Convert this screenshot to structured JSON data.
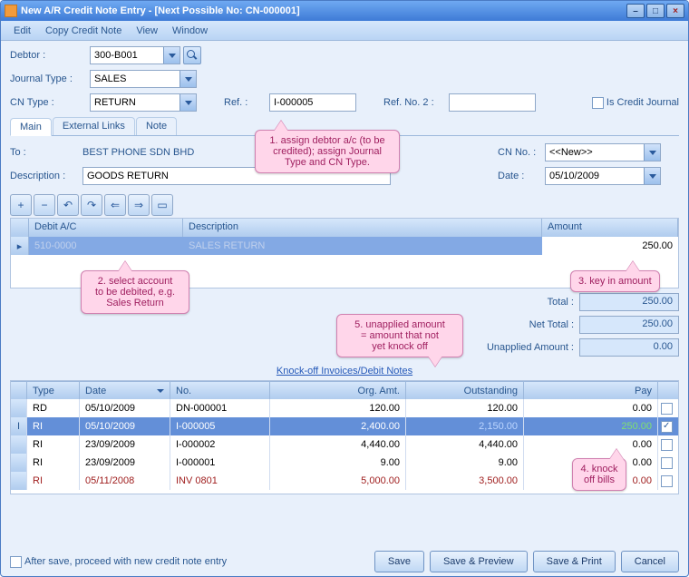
{
  "window": {
    "title": "New A/R Credit Note Entry - [Next Possible No: CN-000001]"
  },
  "menu": {
    "edit": "Edit",
    "copy": "Copy Credit Note",
    "view": "View",
    "window": "Window"
  },
  "labels": {
    "debtor": "Debtor :",
    "journal_type": "Journal Type :",
    "cn_type": "CN Type :",
    "ref": "Ref. :",
    "refno2": "Ref. No. 2 :",
    "is_credit_journal": "Is Credit Journal",
    "to": "To :",
    "description": "Description :",
    "cn_no": "CN No. :",
    "date": "Date :",
    "total": "Total :",
    "net_total": "Net Total :",
    "unapplied": "Unapplied Amount :",
    "knockoff_link": "Knock-off Invoices/Debit Notes",
    "after_save": "After save, proceed with new credit note entry"
  },
  "values": {
    "debtor": "300-B001",
    "journal_type": "SALES",
    "cn_type": "RETURN",
    "ref": "I-000005",
    "refno2": "",
    "to": "BEST PHONE SDN BHD",
    "description": "GOODS RETURN",
    "cn_no": "<<New>>",
    "date": "05/10/2009",
    "total": "250.00",
    "net_total": "250.00",
    "unapplied": "0.00"
  },
  "tabs": {
    "main": "Main",
    "external": "External Links",
    "note": "Note"
  },
  "grid1": {
    "headers": {
      "debit_ac": "Debit A/C",
      "description": "Description",
      "amount": "Amount"
    },
    "row": {
      "debit_ac": "510-0000",
      "description": "SALES RETURN",
      "amount": "250.00"
    }
  },
  "grid2": {
    "headers": {
      "type": "Type",
      "date": "Date",
      "no": "No.",
      "org": "Org. Amt.",
      "outstanding": "Outstanding",
      "pay": "Pay"
    },
    "rows": [
      {
        "sel": "",
        "type": "RD",
        "date": "05/10/2009",
        "no": "DN-000001",
        "org": "120.00",
        "out": "120.00",
        "pay": "0.00",
        "chk": false,
        "red": false
      },
      {
        "sel": "I",
        "type": "RI",
        "date": "05/10/2009",
        "no": "I-000005",
        "org": "2,400.00",
        "out": "2,150.00",
        "pay": "250.00",
        "chk": true,
        "red": false,
        "selected": true
      },
      {
        "sel": "",
        "type": "RI",
        "date": "23/09/2009",
        "no": "I-000002",
        "org": "4,440.00",
        "out": "4,440.00",
        "pay": "0.00",
        "chk": false,
        "red": false
      },
      {
        "sel": "",
        "type": "RI",
        "date": "23/09/2009",
        "no": "I-000001",
        "org": "9.00",
        "out": "9.00",
        "pay": "0.00",
        "chk": false,
        "red": false
      },
      {
        "sel": "",
        "type": "RI",
        "date": "05/11/2008",
        "no": "INV 0801",
        "org": "5,000.00",
        "out": "3,500.00",
        "pay": "0.00",
        "chk": false,
        "red": true
      }
    ]
  },
  "buttons": {
    "save": "Save",
    "save_preview": "Save & Preview",
    "save_print": "Save & Print",
    "cancel": "Cancel"
  },
  "callouts": {
    "c1": "1. assign debtor a/c (to be\ncredited); assign Journal\nType and CN Type.",
    "c2": "2. select account\nto be debited, e.g.\nSales Return",
    "c3": "3. key in amount",
    "c4": "4. knock\noff bills",
    "c5": "5. unapplied amount\n= amount that not\nyet knock off"
  }
}
